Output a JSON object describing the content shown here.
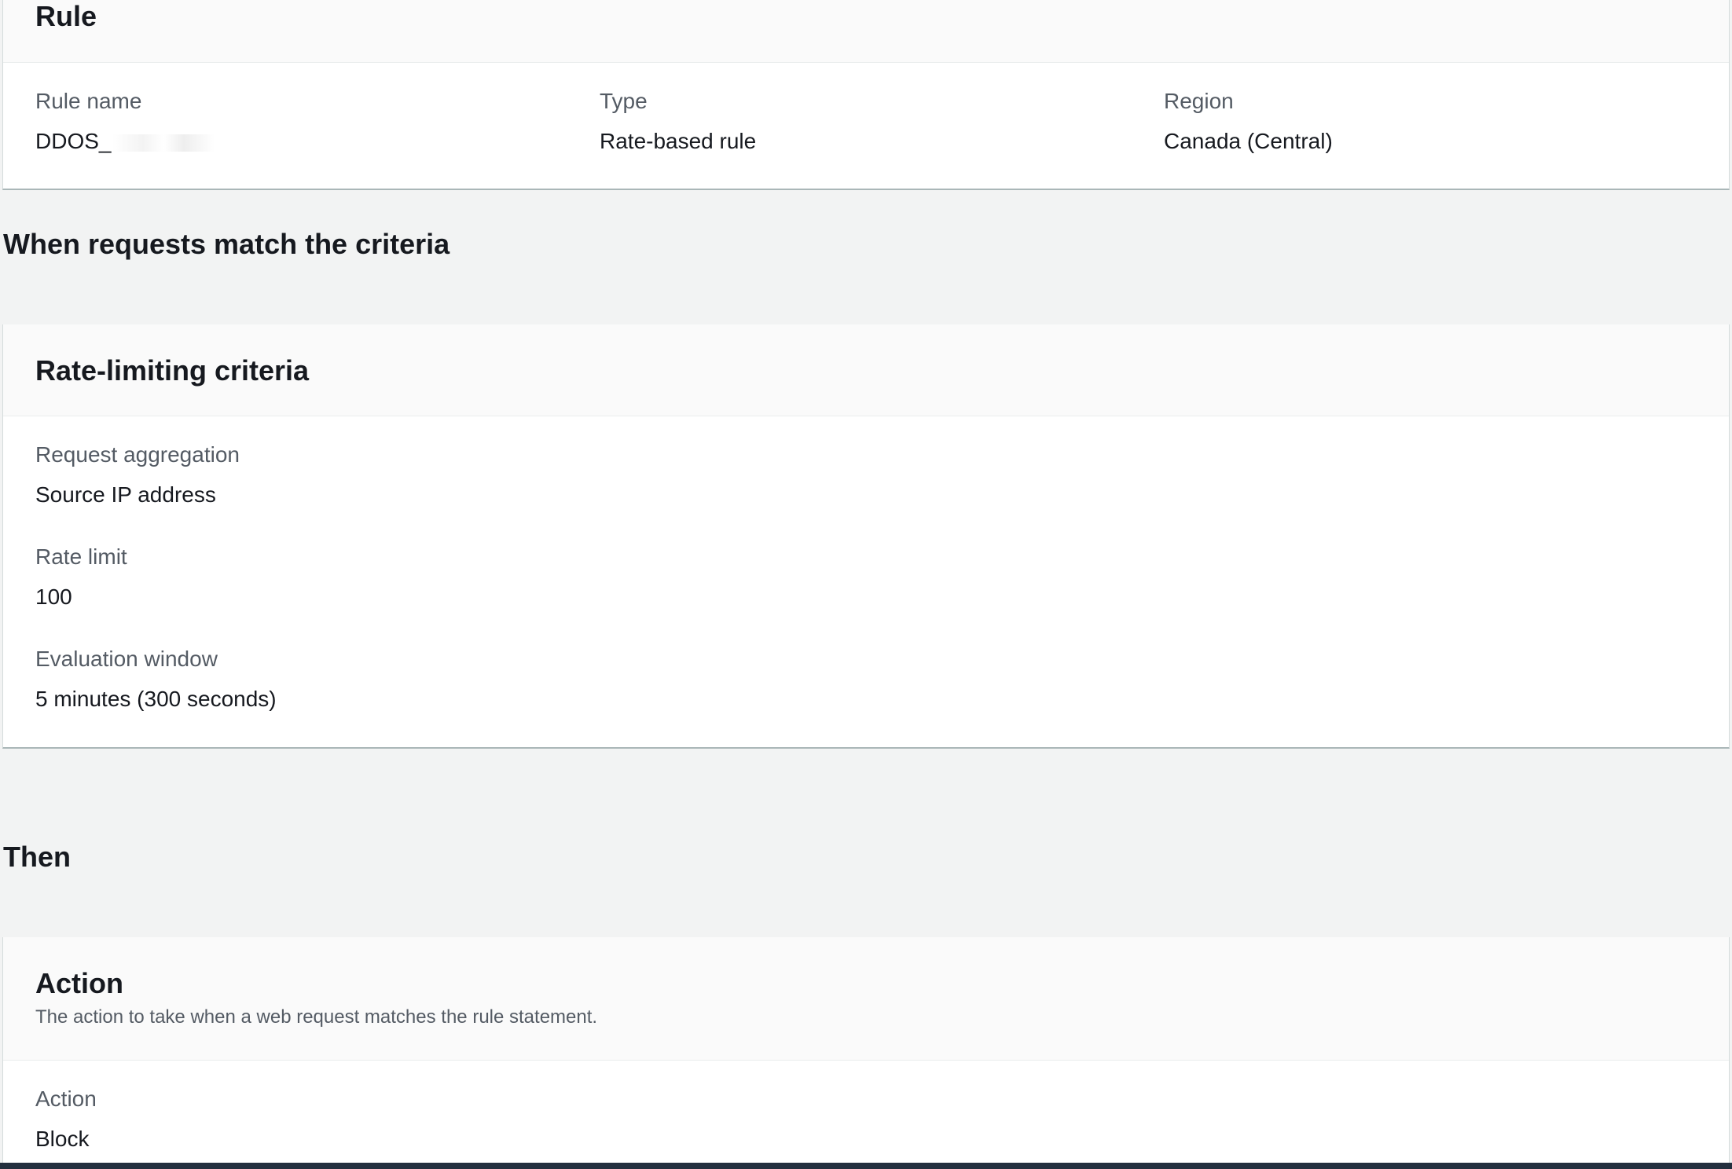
{
  "rule_panel": {
    "title": "Rule",
    "fields": [
      {
        "label": "Rule name",
        "value": "DDOS_"
      },
      {
        "label": "Type",
        "value": "Rate-based rule"
      },
      {
        "label": "Region",
        "value": "Canada (Central)"
      }
    ]
  },
  "criteria_section": {
    "heading": "When requests match the criteria"
  },
  "rate_panel": {
    "title": "Rate-limiting criteria",
    "fields": [
      {
        "label": "Request aggregation",
        "value": "Source IP address"
      },
      {
        "label": "Rate limit",
        "value": "100"
      },
      {
        "label": "Evaluation window",
        "value": "5 minutes (300 seconds)"
      }
    ]
  },
  "then_section": {
    "heading": "Then"
  },
  "action_panel": {
    "title": "Action",
    "description": "The action to take when a web request matches the rule statement.",
    "fields": [
      {
        "label": "Action",
        "value": "Block"
      }
    ]
  }
}
